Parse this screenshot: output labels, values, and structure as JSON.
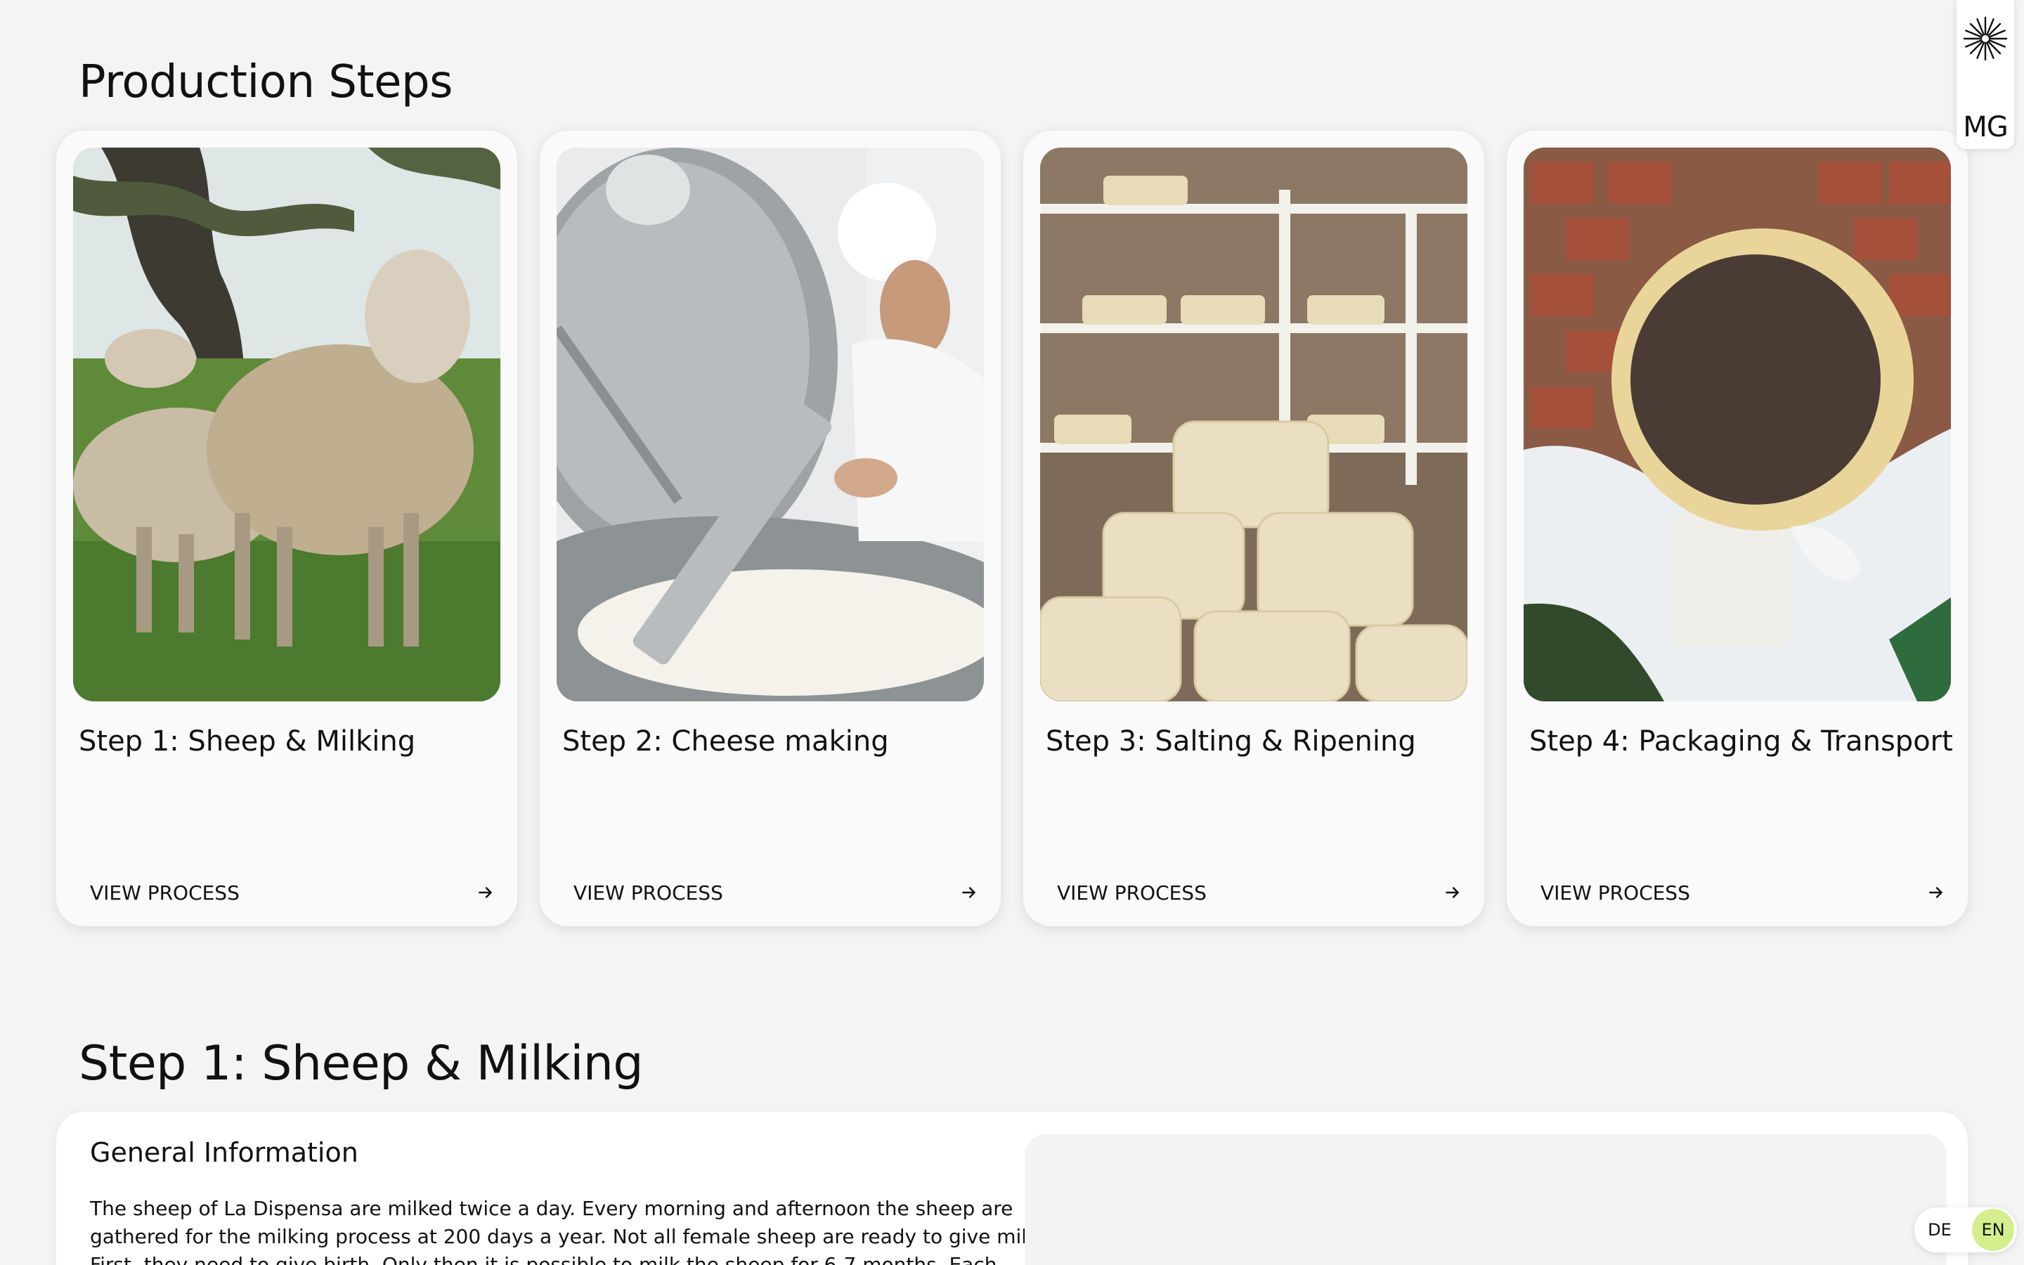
{
  "page": {
    "section_title": "Production Steps",
    "detail_title": "Step 1: Sheep & Milking"
  },
  "steps": [
    {
      "title": "Step 1: Sheep & Milking",
      "link_label": "VIEW PROCESS",
      "image": "sheep-grazing-photo"
    },
    {
      "title": "Step 2: Cheese making",
      "link_label": "VIEW PROCESS",
      "image": "cheesemaker-vat-photo"
    },
    {
      "title": "Step 3: Salting & Ripening",
      "link_label": "VIEW PROCESS",
      "image": "cheese-wheels-shelves-photo"
    },
    {
      "title": "Step 4: Packaging & Transport",
      "link_label": "VIEW PROCESS",
      "image": "pecorino-wheel-photo"
    }
  ],
  "detail": {
    "heading": "General Information",
    "text": "The sheep of La Dispensa are milked twice a day. Every morning and afternoon the sheep are gathered for the milking process at 200 days a year. Not all female sheep are ready to give milk. First, they need to give birth. Only then it is possible to milk the sheep for 6-7 months. Each"
  },
  "brand": {
    "initials": "MG",
    "logo_icon": "starburst-icon"
  },
  "language": {
    "options": [
      "DE",
      "EN"
    ],
    "active": "EN",
    "active_color": "#d4ee8c"
  },
  "colors": {
    "background": "#f4f4f4",
    "card": "#fafafa",
    "text": "#111111"
  }
}
